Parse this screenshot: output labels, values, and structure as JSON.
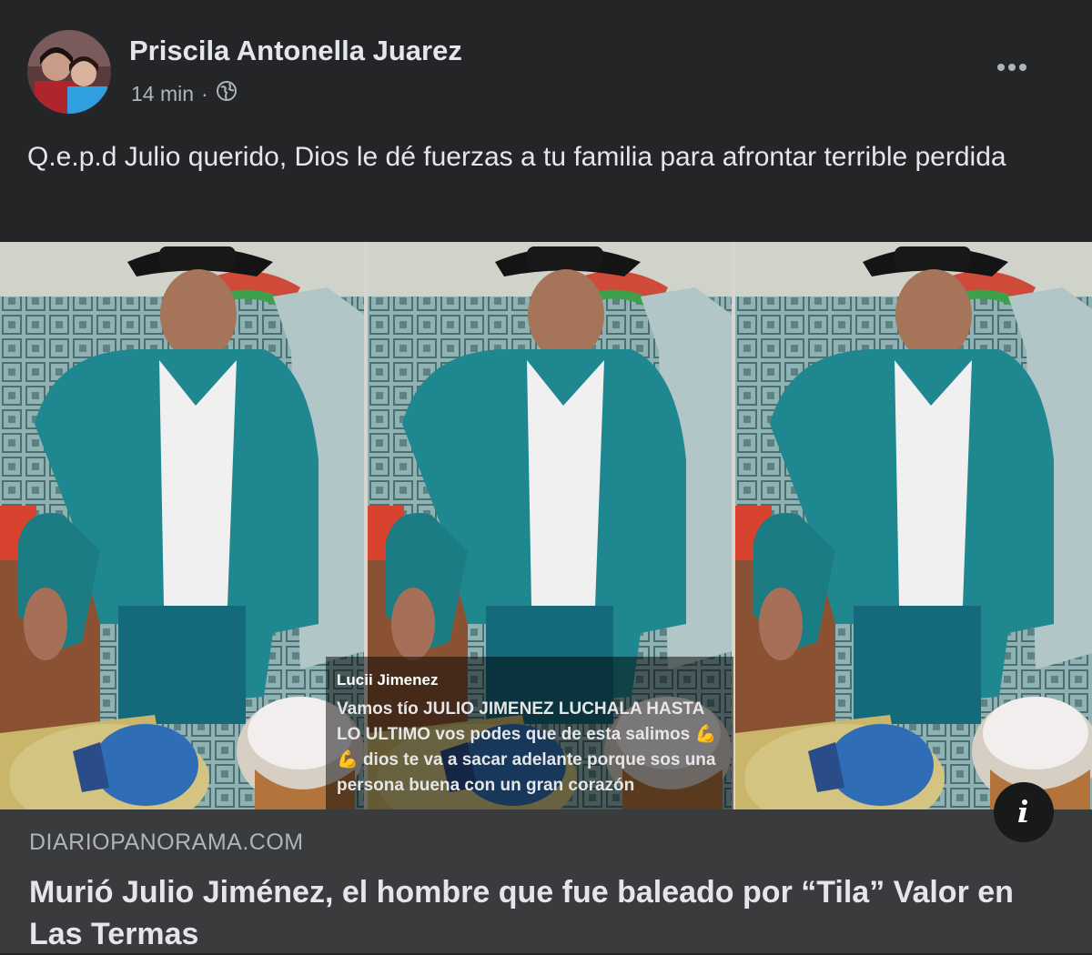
{
  "post": {
    "author": "Priscila Antonella Juarez",
    "time": "14 min",
    "separator": "·",
    "privacy_icon": "globe-icon",
    "more_icon": "more-horizontal-icon",
    "text": "Q.e.p.d Julio querido, Dios le dé fuerzas a tu familia para afrontar terrible perdida"
  },
  "image_caption": {
    "name": "Lucii Jimenez",
    "text": "Vamos tío JULIO JIMENEZ LUCHALA HASTA LO ULTIMO vos podes que de esta salimos 💪💪 dios te va a sacar adelante porque sos una persona buena con un gran corazón"
  },
  "link": {
    "domain": "DIARIOPANORAMA.COM",
    "title": "Murió Julio Jiménez, el hombre que fue baleado por “Tila” Valor en Las Termas",
    "info_icon": "info-icon"
  },
  "colors": {
    "background": "#242526",
    "link_background": "#3a3b3c",
    "text_primary": "#e4e6eb",
    "text_secondary": "#b0b3b8"
  }
}
